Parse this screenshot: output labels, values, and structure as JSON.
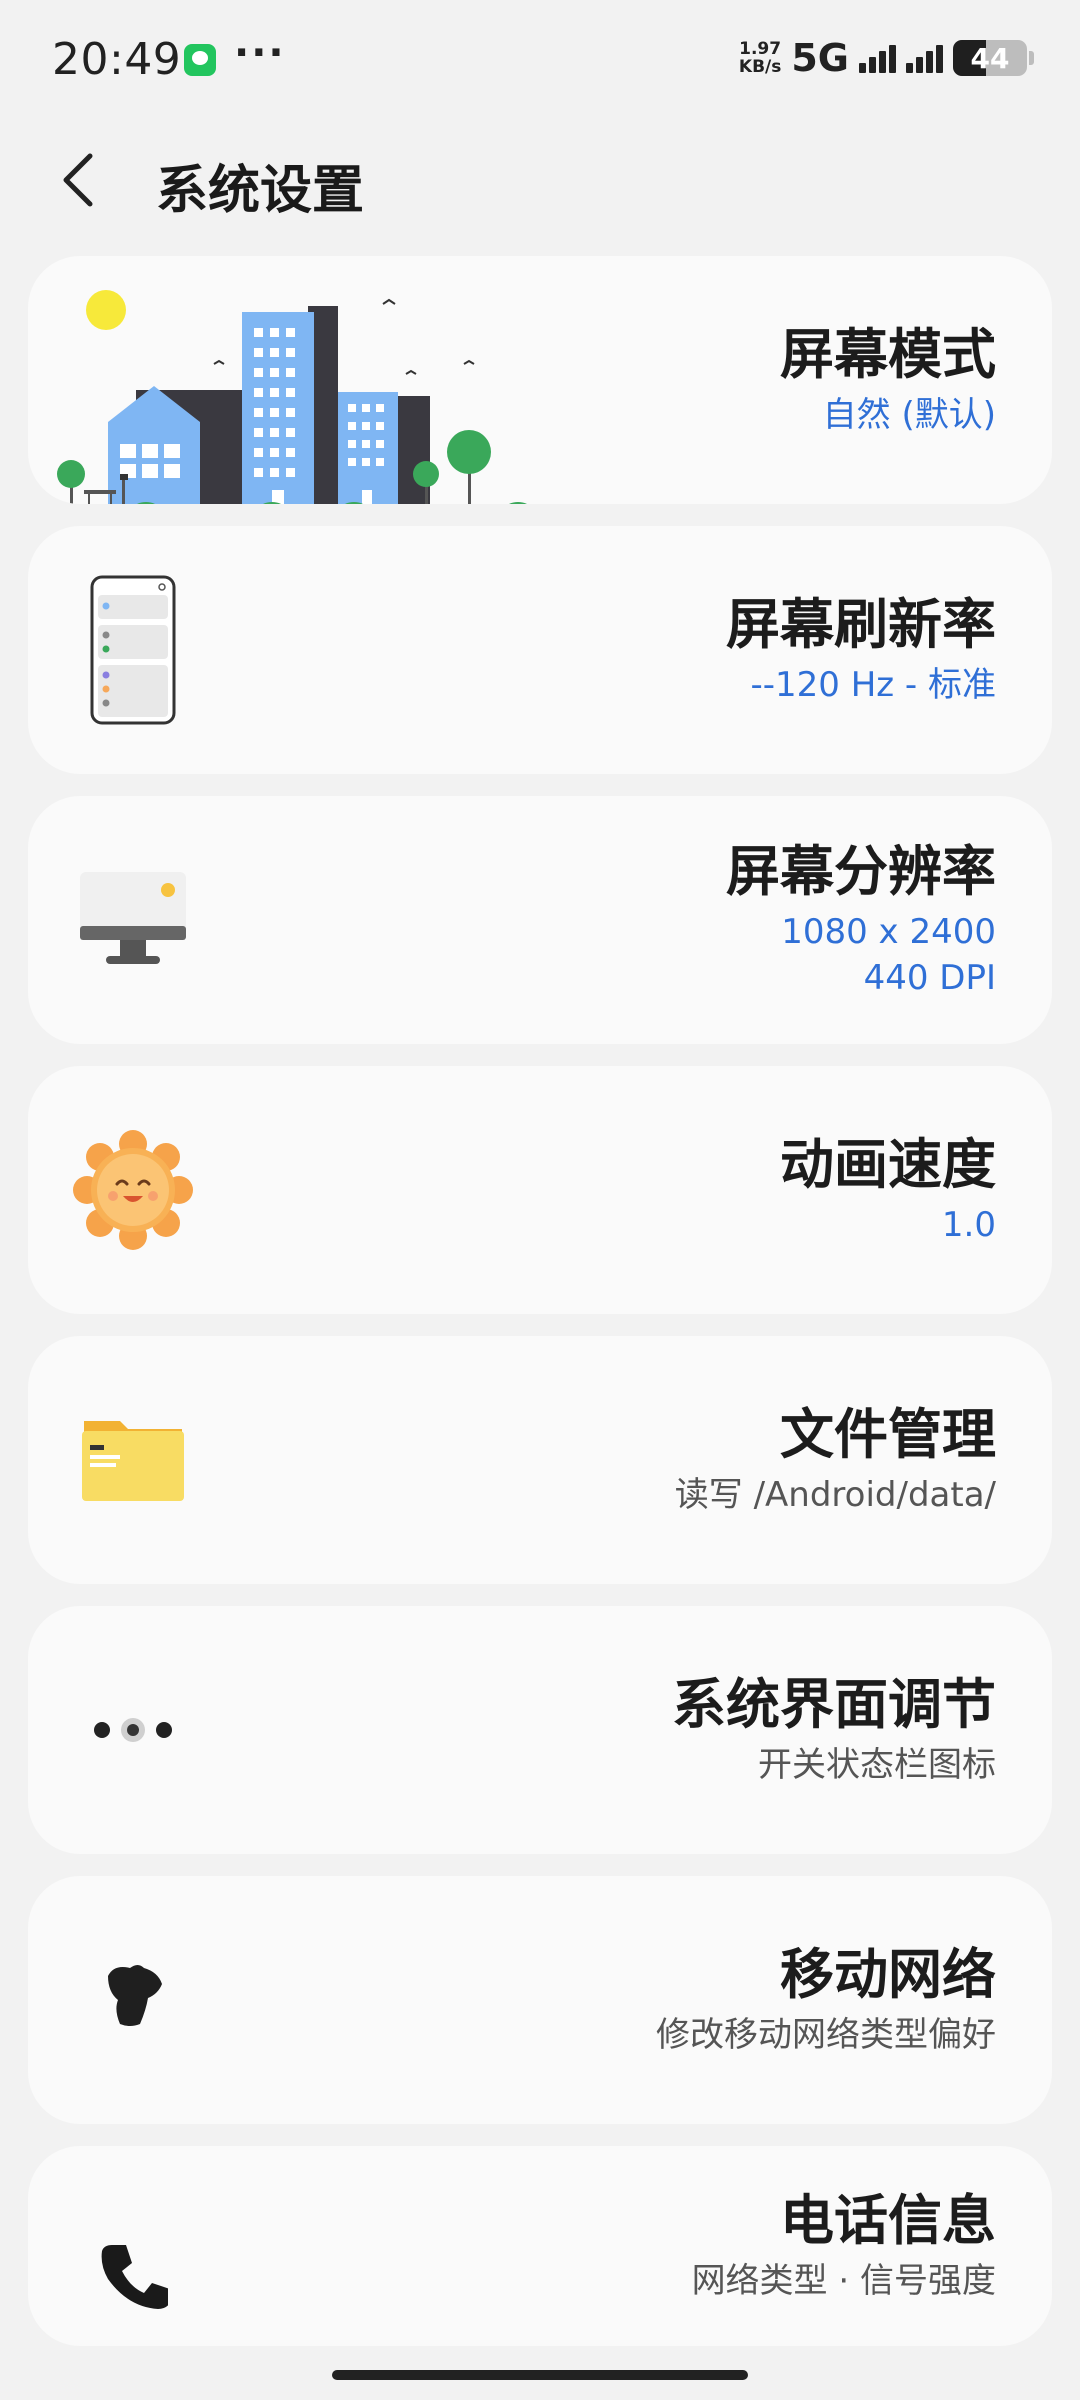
{
  "status_bar": {
    "time": "20:49",
    "notification_icon": "chat-app-icon",
    "more_indicator": "···",
    "net_speed_value": "1.97",
    "net_speed_unit": "KB/s",
    "network_type": "5G",
    "battery_level": "44"
  },
  "header": {
    "back_icon": "chevron-left-icon",
    "title": "系统设置"
  },
  "settings": [
    {
      "title": "屏幕模式",
      "subtitle": "自然 (默认)",
      "icon": "city-illustration"
    },
    {
      "title": "屏幕刷新率",
      "subtitle": "--120 Hz - 标准",
      "icon": "phone-icon"
    },
    {
      "title": "屏幕分辨率",
      "subtitle": "1080 x 2400",
      "subtitle2": "440 DPI",
      "icon": "monitor-icon"
    },
    {
      "title": "动画速度",
      "subtitle": "1.0",
      "icon": "sun-face-icon"
    },
    {
      "title": "文件管理",
      "subtitle": "读写 /Android/data/",
      "icon": "folder-icon"
    },
    {
      "title": "系统界面调节",
      "subtitle": "开关状态栏图标",
      "icon": "dots-icon"
    },
    {
      "title": "移动网络",
      "subtitle": "修改移动网络类型偏好",
      "icon": "mobile-network-icon"
    },
    {
      "title": "电话信息",
      "subtitle": "网络类型 · 信号强度",
      "icon": "phone-handset-icon"
    }
  ],
  "colors": {
    "accent_blue": "#2f6fd6",
    "card_bg": "#fafafa",
    "page_bg": "#f2f2f2"
  }
}
